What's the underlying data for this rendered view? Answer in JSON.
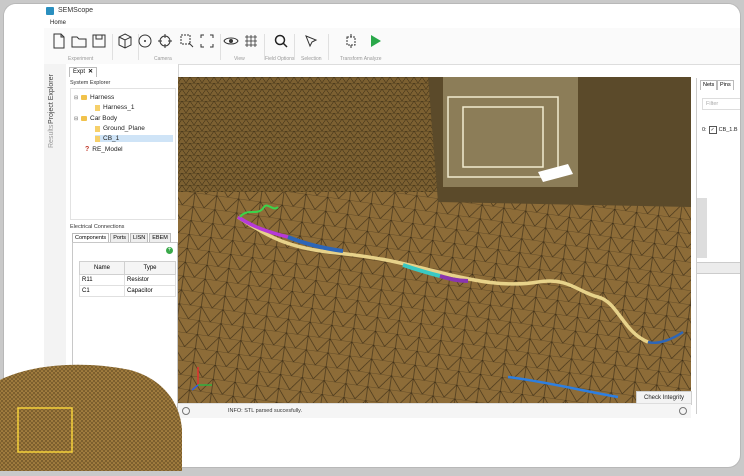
{
  "window": {
    "title": "SEMScope"
  },
  "menu": {
    "home": "Home"
  },
  "ribbon": {
    "groups": {
      "experiment": "Experiment",
      "camera": "Camera",
      "view": "View",
      "field_options": "Field Options",
      "selection": "Selection",
      "transform_analyze": "Transform   Analyze"
    }
  },
  "sidetabs": {
    "project_explorer": "Project Explorer",
    "results": "Results"
  },
  "explorer": {
    "tab_label": "Expt",
    "system_explorer_title": "System Explorer",
    "tree": {
      "harness": "Harness",
      "harness_1": "Harness_1",
      "car_body": "Car Body",
      "ground_plane": "Ground_Plane",
      "cb_1": "CB_1",
      "re_model": "RE_Model"
    },
    "electrical_connections_title": "Electrical Connections",
    "ec_tabs": [
      "Components",
      "Ports",
      "LISN",
      "EBEM"
    ],
    "table": {
      "headers": [
        "Name",
        "Type"
      ],
      "rows": [
        [
          "R11",
          "Resistor"
        ],
        [
          "C1",
          "Capacitor"
        ]
      ]
    }
  },
  "status": {
    "info": "INFO: STL parsed succesfully."
  },
  "check_integrity": "Check Integrity",
  "right_panel": {
    "tabs": [
      "Nets",
      "Pins"
    ],
    "filter_placeholder": "Filter",
    "row_index": "0:",
    "row_label": "CB_1.B"
  },
  "colors": {
    "viewport_ground": "#8a6a35",
    "accent": "#2a8fbf",
    "play": "#2aa84a"
  }
}
